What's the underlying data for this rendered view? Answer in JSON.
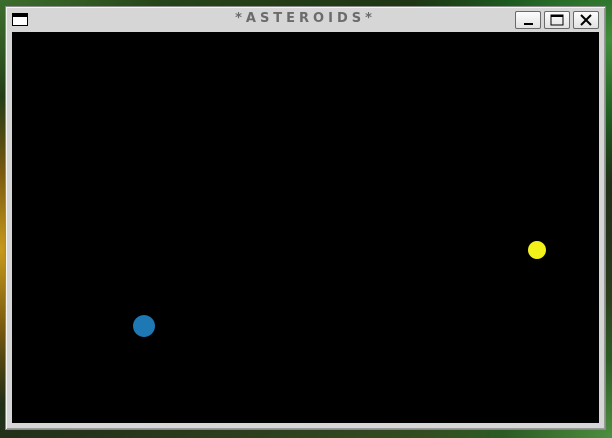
{
  "window": {
    "title": "*ASTEROIDS*",
    "buttons": {
      "minimize": "minimize-icon",
      "maximize": "maximize-icon",
      "close": "close-icon"
    }
  },
  "game": {
    "background_color": "#000000",
    "objects": [
      {
        "name": "player-ship",
        "color": "#1e78b4"
      },
      {
        "name": "asteroid",
        "color": "#f2f21a"
      }
    ]
  }
}
